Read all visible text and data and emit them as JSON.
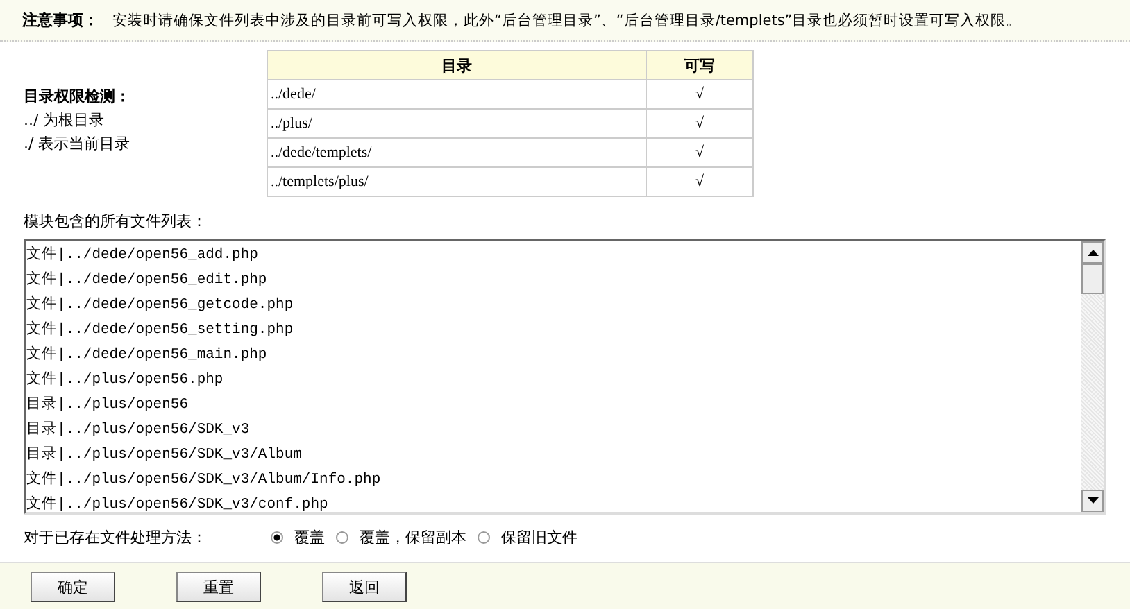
{
  "notice": {
    "label": "注意事项：",
    "text": "安装时请确保文件列表中涉及的目录前可写入权限，此外“后台管理目录”、“后台管理目录/templets”目录也必须暂时设置可写入权限。"
  },
  "permission_check": {
    "title": "目录权限检测：",
    "notes": [
      "../ 为根目录",
      "./ 表示当前目录"
    ],
    "columns": [
      "目录",
      "可写"
    ],
    "rows": [
      {
        "dir": "../dede/",
        "writable": "√"
      },
      {
        "dir": "../plus/",
        "writable": "√"
      },
      {
        "dir": "../dede/templets/",
        "writable": "√"
      },
      {
        "dir": "../templets/plus/",
        "writable": "√"
      }
    ]
  },
  "file_list": {
    "label": "模块包含的所有文件列表：",
    "items": [
      "文件|../dede/open56_add.php",
      "文件|../dede/open56_edit.php",
      "文件|../dede/open56_getcode.php",
      "文件|../dede/open56_setting.php",
      "文件|../dede/open56_main.php",
      "文件|../plus/open56.php",
      "目录|../plus/open56",
      "目录|../plus/open56/SDK_v3",
      "目录|../plus/open56/SDK_v3/Album",
      "文件|../plus/open56/SDK_v3/Album/Info.php",
      "文件|../plus/open56/SDK_v3/conf.php"
    ]
  },
  "existing_files": {
    "label": "对于已存在文件处理方法：",
    "options": [
      {
        "label": "覆盖",
        "selected": true
      },
      {
        "label": "覆盖，保留副本",
        "selected": false
      },
      {
        "label": "保留旧文件",
        "selected": false
      }
    ]
  },
  "buttons": [
    "确定",
    "重置",
    "返回"
  ]
}
